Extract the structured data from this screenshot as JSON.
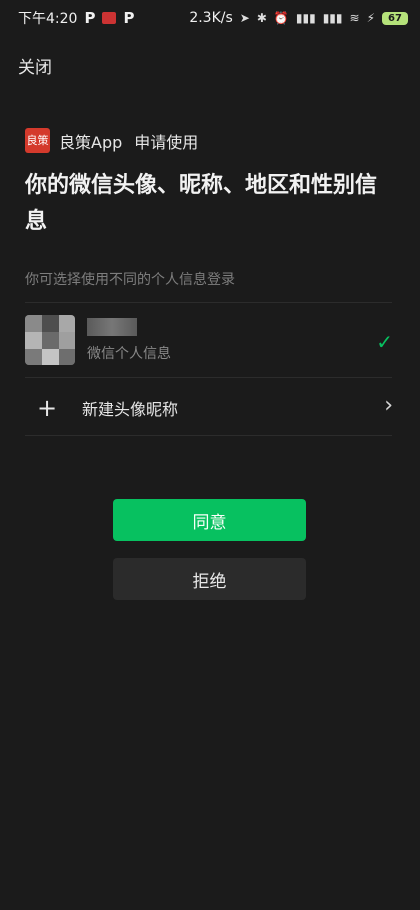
{
  "statusbar": {
    "time": "下午4:20",
    "speed": "2.3K/s",
    "battery": "67"
  },
  "header": {
    "close_label": "关闭"
  },
  "app": {
    "logo_text": "良策",
    "name": "良策App",
    "request_label": "申请使用"
  },
  "title": "你的微信头像、昵称、地区和性别信息",
  "hint": "你可选择使用不同的个人信息登录",
  "profile": {
    "subtitle": "微信个人信息"
  },
  "new_profile": {
    "label": "新建头像昵称"
  },
  "buttons": {
    "agree": "同意",
    "refuse": "拒绝"
  },
  "colors": {
    "accent": "#07c160",
    "background": "#1b1b1b"
  }
}
